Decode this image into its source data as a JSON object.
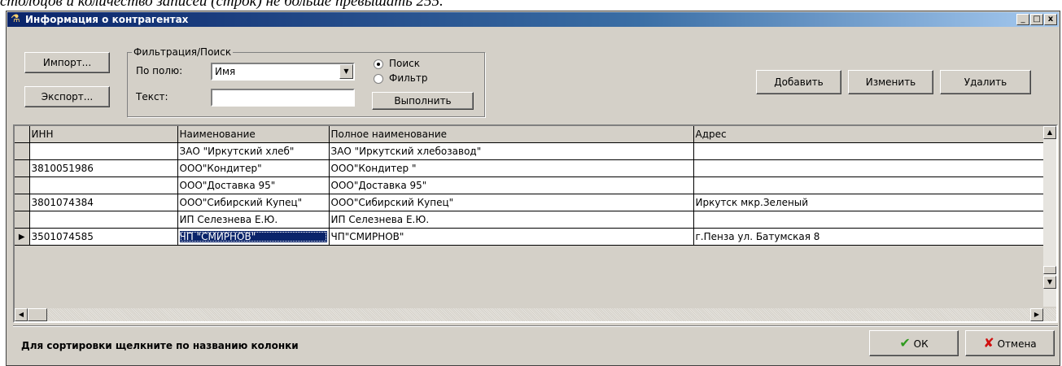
{
  "page_caption": "столбцов и количество записей (строк) не больше превышать 255.",
  "window": {
    "title": "Информация о контрагентах",
    "min": "_",
    "max": "□",
    "close": "x"
  },
  "toolbar": {
    "import_label": "Импорт...",
    "export_label": "Экспорт...",
    "add_label": "Добавить",
    "edit_label": "Изменить",
    "delete_label": "Удалить"
  },
  "filter": {
    "group_label": "Фильтрация/Поиск",
    "field_label": "По полю:",
    "field_value": "Имя",
    "text_label": "Текст:",
    "text_value": "",
    "mode_search": "Поиск",
    "mode_filter": "Фильтр",
    "mode_selected": "search",
    "execute_label": "Выполнить"
  },
  "grid": {
    "columns": [
      "ИНН",
      "Наименование",
      "Полное наименование",
      "Адрес"
    ],
    "rows": [
      [
        "",
        "ЗАО \"Иркутский хлеб\"",
        "ЗАО \"Иркутский хлебозавод\"",
        ""
      ],
      [
        "3810051986",
        "ООО\"Кондитер\"",
        "ООО\"Кондитер \"",
        ""
      ],
      [
        "",
        "ООО\"Доставка 95\"",
        "ООО\"Доставка 95\"",
        ""
      ],
      [
        "3801074384",
        "ООО\"Сибирский Купец\"",
        "ООО\"Сибирский Купец\"",
        "Иркутск мкр.Зеленый"
      ],
      [
        "",
        "ИП Селезнева Е.Ю.",
        "ИП Селезнева Е.Ю.",
        ""
      ],
      [
        "3501074585",
        "ЧП \"СМИРНОВ\"",
        "ЧП\"СМИРНОВ\"",
        "г.Пенза ул. Батумская 8"
      ]
    ],
    "current_row": 5
  },
  "footer": {
    "hint": "Для сортировки щелкните по названию колонки",
    "ok_label": "ОК",
    "cancel_label": "Отмена"
  },
  "colors": {
    "title_bar": "#0a246a",
    "selection": "#0a246a",
    "ok_check": "#2e9a1e",
    "cancel_x": "#d01010"
  }
}
